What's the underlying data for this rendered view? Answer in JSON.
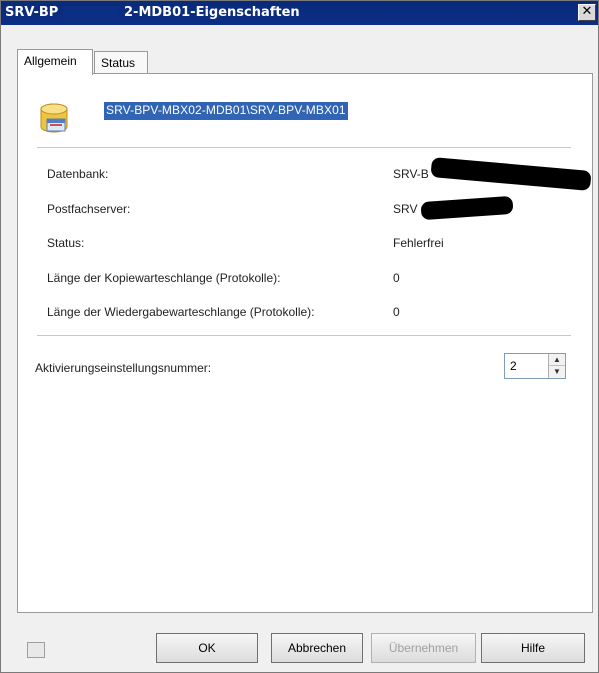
{
  "window": {
    "title_prefix": "SRV-BP",
    "title_suffix": "2-MDB01-Eigenschaften",
    "close_glyph": "✕"
  },
  "tabs": [
    {
      "label": "Allgemein",
      "active": true
    },
    {
      "label": "Status",
      "active": false
    }
  ],
  "header": {
    "icon": "database-icon",
    "name": "SRV-BPV-MBX02-MDB01\\SRV-BPV-MBX01"
  },
  "properties": [
    {
      "label": "Datenbank:",
      "value": "SRV-B"
    },
    {
      "label": "Postfachserver:",
      "value": "SRV"
    },
    {
      "label": "Status:",
      "value": "Fehlerfrei"
    },
    {
      "label": "Länge der Kopiewarteschlange (Protokolle):",
      "value": "0"
    },
    {
      "label": "Länge der Wiedergabewarteschlange (Protokolle):",
      "value": "0"
    }
  ],
  "activation": {
    "label": "Aktivierungseinstellungsnummer:",
    "value": "2"
  },
  "buttons": {
    "ok": "OK",
    "cancel": "Abbrechen",
    "apply": "Übernehmen",
    "help": "Hilfe"
  },
  "colors": {
    "title_bar": "#0b2f85",
    "selection": "#3164b4"
  }
}
